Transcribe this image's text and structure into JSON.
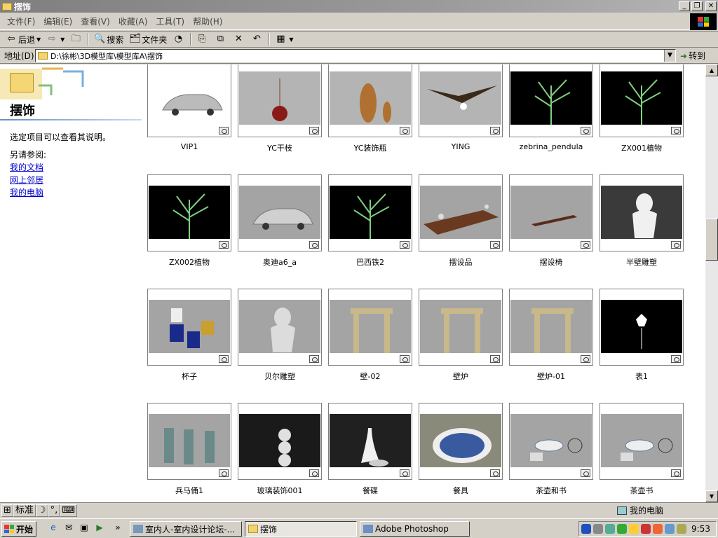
{
  "window": {
    "title": "摆饰"
  },
  "menu": [
    "文件(F)",
    "编辑(E)",
    "查看(V)",
    "收藏(A)",
    "工具(T)",
    "帮助(H)"
  ],
  "toolbar": {
    "back": "后退",
    "search": "搜索",
    "folders": "文件夹"
  },
  "address": {
    "label": "地址(D)",
    "path": "D:\\徐彬\\3D模型库\\模型库A\\摆饰",
    "go": "转到"
  },
  "sidebar": {
    "title": "摆饰",
    "desc": "选定项目可以查看其说明。",
    "see_also": "另请参阅:",
    "links": [
      "我的文档",
      "网上邻居",
      "我的电脑"
    ]
  },
  "files": [
    {
      "name": "VIP1",
      "icon": "car-outline-icon"
    },
    {
      "name": "YC干枝",
      "icon": "vase-icon"
    },
    {
      "name": "YC装饰瓶",
      "icon": "vases-icon"
    },
    {
      "name": "YING",
      "icon": "eagle-icon"
    },
    {
      "name": "zebrina_pendula",
      "icon": "plant-icon"
    },
    {
      "name": "ZX001植物",
      "icon": "plant-icon"
    },
    {
      "name": "ZX002植物",
      "icon": "plant-icon"
    },
    {
      "name": "奥迪a6_a",
      "icon": "car-icon"
    },
    {
      "name": "巴西铁2",
      "icon": "plant-icon"
    },
    {
      "name": "摆设品",
      "icon": "table-icon"
    },
    {
      "name": "摆设椅",
      "icon": "bench-icon"
    },
    {
      "name": "半壁雕塑",
      "icon": "statue-icon"
    },
    {
      "name": "杯子",
      "icon": "cups-icon"
    },
    {
      "name": "贝尔雕塑",
      "icon": "bust-icon"
    },
    {
      "name": "壁-02",
      "icon": "fireplace-icon"
    },
    {
      "name": "壁炉",
      "icon": "fireplace-icon"
    },
    {
      "name": "壁炉-01",
      "icon": "fireplace-icon"
    },
    {
      "name": "表1",
      "icon": "clock-icon"
    },
    {
      "name": "兵马俑1",
      "icon": "warriors-icon"
    },
    {
      "name": "玻璃装饰001",
      "icon": "glass-balls-icon"
    },
    {
      "name": "餐碟",
      "icon": "dish-icon"
    },
    {
      "name": "餐具",
      "icon": "plate-icon"
    },
    {
      "name": "茶壶和书",
      "icon": "teapot-icon"
    },
    {
      "name": "茶壶书",
      "icon": "teapot-icon"
    }
  ],
  "statusbar": {
    "ime": "标准",
    "location": "我的电脑"
  },
  "taskbar": {
    "start": "开始",
    "tasks": [
      "室内人-室内设计论坛-...",
      "摆饰",
      "Adobe Photoshop"
    ],
    "clock": "9:53"
  },
  "colors": {
    "title_bar": "#8c8c8c",
    "link": "#0000cc",
    "face": "#d4d0c8"
  }
}
